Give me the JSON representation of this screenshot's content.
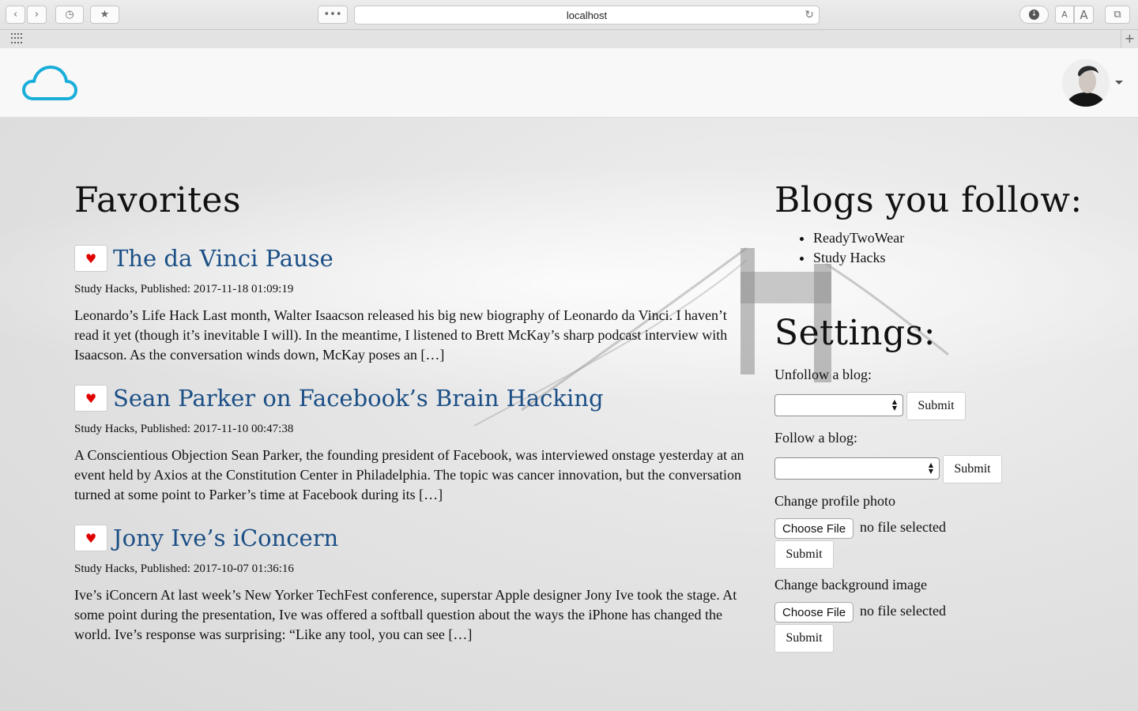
{
  "browser": {
    "url": "localhost",
    "back_icon": "chevron-left-icon",
    "forward_icon": "chevron-right-icon",
    "history_icon": "clock-icon",
    "bookmarks_icon": "star-icon",
    "more_icon": "ellipsis-icon",
    "reload_icon": "reload-icon",
    "download_icon": "download-icon",
    "font_small": "A",
    "font_large": "A",
    "tabs_icon": "tabs-icon",
    "new_tab": "+"
  },
  "header": {
    "logo": "cloud-logo",
    "accent_color": "#19aed9"
  },
  "favorites": {
    "title": "Favorites",
    "posts": [
      {
        "title": "The da Vinci Pause",
        "meta": "Study Hacks, Published: 2017-11-18 01:09:19",
        "body": "Leonardo’s Life Hack Last month, Walter Isaacson released his big new biography of Leonardo da Vinci. I haven’t read it yet (though it’s inevitable I will). In the meantime, I listened to Brett McKay’s sharp podcast interview with Isaacson. As the conversation winds down, McKay poses an […]"
      },
      {
        "title": "Sean Parker on Facebook’s Brain Hacking",
        "meta": "Study Hacks, Published: 2017-11-10 00:47:38",
        "body": "A Conscientious Objection  Sean Parker, the founding president of Facebook, was interviewed onstage yesterday at an event held by Axios at the Constitution Center in Philadelphia. The topic was cancer innovation, but the conversation turned at some point to Parker’s time at Facebook during its […]"
      },
      {
        "title": "Jony Ive’s iConcern",
        "meta": "Study Hacks, Published: 2017-10-07 01:36:16",
        "body": "Ive’s iConcern At last week’s New Yorker TechFest conference, superstar Apple designer Jony Ive took the stage. At some point during the presentation, Ive was offered a softball question about the ways the iPhone has changed the world. Ive’s response was surprising: “Like any tool, you can see […]"
      }
    ],
    "heart_color": "#e00000"
  },
  "follow": {
    "title": "Blogs you follow:",
    "blogs": [
      "ReadyTwoWear",
      "Study Hacks"
    ]
  },
  "settings": {
    "title": "Settings:",
    "unfollow_label": "Unfollow a blog:",
    "follow_label": "Follow a blog:",
    "profile_label": "Change profile photo",
    "background_label": "Change background image",
    "submit": "Submit",
    "choose_file": "Choose File",
    "no_file": "no file selected"
  }
}
